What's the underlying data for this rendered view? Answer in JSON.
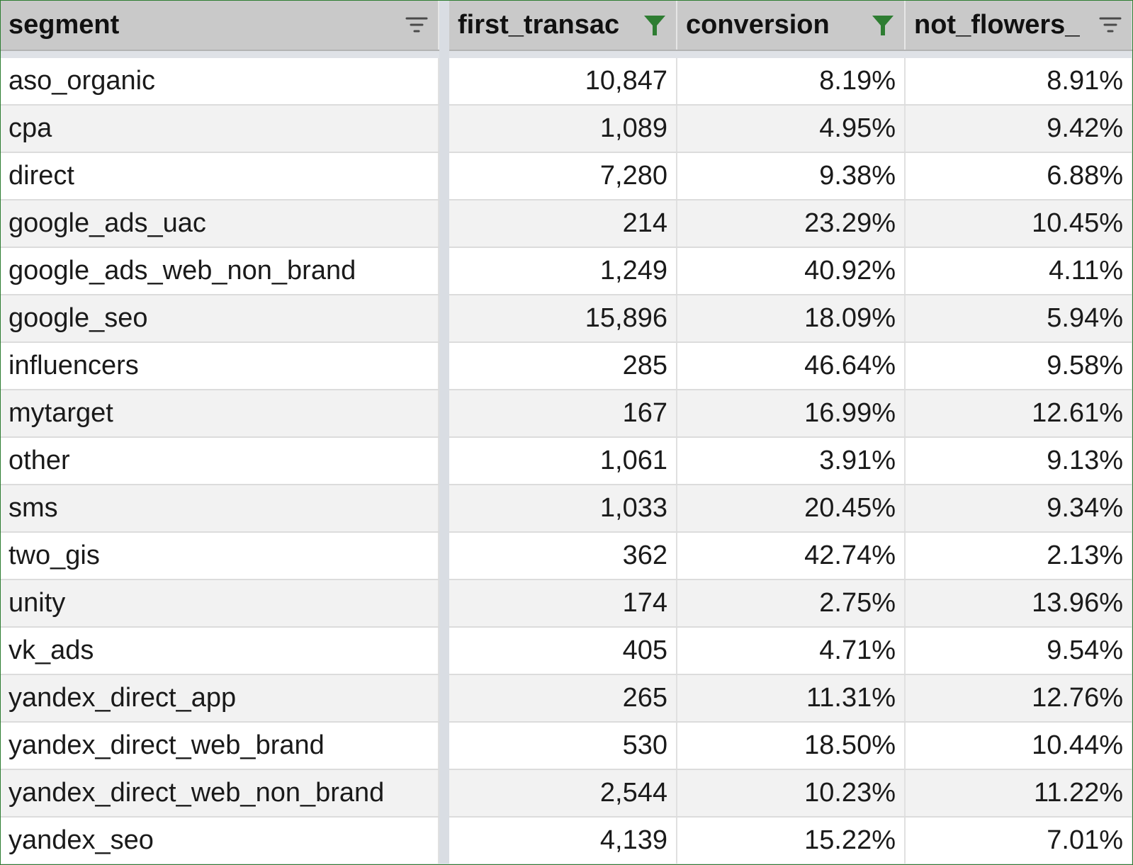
{
  "table": {
    "columns": [
      {
        "label": "segment",
        "filter_active": false
      },
      {
        "label": "first_transac",
        "filter_active": true
      },
      {
        "label": "conversion",
        "filter_active": true
      },
      {
        "label": "not_flowers_",
        "filter_active": false
      }
    ],
    "rows": [
      {
        "segment": "aso_organic",
        "first_transactions": "10,847",
        "conversion": "8.19%",
        "not_flowers": "8.91%"
      },
      {
        "segment": "cpa",
        "first_transactions": "1,089",
        "conversion": "4.95%",
        "not_flowers": "9.42%"
      },
      {
        "segment": "direct",
        "first_transactions": "7,280",
        "conversion": "9.38%",
        "not_flowers": "6.88%"
      },
      {
        "segment": "google_ads_uac",
        "first_transactions": "214",
        "conversion": "23.29%",
        "not_flowers": "10.45%"
      },
      {
        "segment": "google_ads_web_non_brand",
        "first_transactions": "1,249",
        "conversion": "40.92%",
        "not_flowers": "4.11%"
      },
      {
        "segment": "google_seo",
        "first_transactions": "15,896",
        "conversion": "18.09%",
        "not_flowers": "5.94%"
      },
      {
        "segment": "influencers",
        "first_transactions": "285",
        "conversion": "46.64%",
        "not_flowers": "9.58%"
      },
      {
        "segment": "mytarget",
        "first_transactions": "167",
        "conversion": "16.99%",
        "not_flowers": "12.61%"
      },
      {
        "segment": "other",
        "first_transactions": "1,061",
        "conversion": "3.91%",
        "not_flowers": "9.13%"
      },
      {
        "segment": "sms",
        "first_transactions": "1,033",
        "conversion": "20.45%",
        "not_flowers": "9.34%"
      },
      {
        "segment": "two_gis",
        "first_transactions": "362",
        "conversion": "42.74%",
        "not_flowers": "2.13%"
      },
      {
        "segment": "unity",
        "first_transactions": "174",
        "conversion": "2.75%",
        "not_flowers": "13.96%"
      },
      {
        "segment": "vk_ads",
        "first_transactions": "405",
        "conversion": "4.71%",
        "not_flowers": "9.54%"
      },
      {
        "segment": "yandex_direct_app",
        "first_transactions": "265",
        "conversion": "11.31%",
        "not_flowers": "12.76%"
      },
      {
        "segment": "yandex_direct_web_brand",
        "first_transactions": "530",
        "conversion": "18.50%",
        "not_flowers": "10.44%"
      },
      {
        "segment": "yandex_direct_web_non_brand",
        "first_transactions": "2,544",
        "conversion": "10.23%",
        "not_flowers": "11.22%"
      },
      {
        "segment": "yandex_seo",
        "first_transactions": "4,139",
        "conversion": "15.22%",
        "not_flowers": "7.01%"
      }
    ]
  },
  "colors": {
    "accent_green": "#2e7d32",
    "filter_inactive": "#4a4a4a",
    "header_bg": "#c9c9c9",
    "band_bg": "#f2f2f2"
  }
}
